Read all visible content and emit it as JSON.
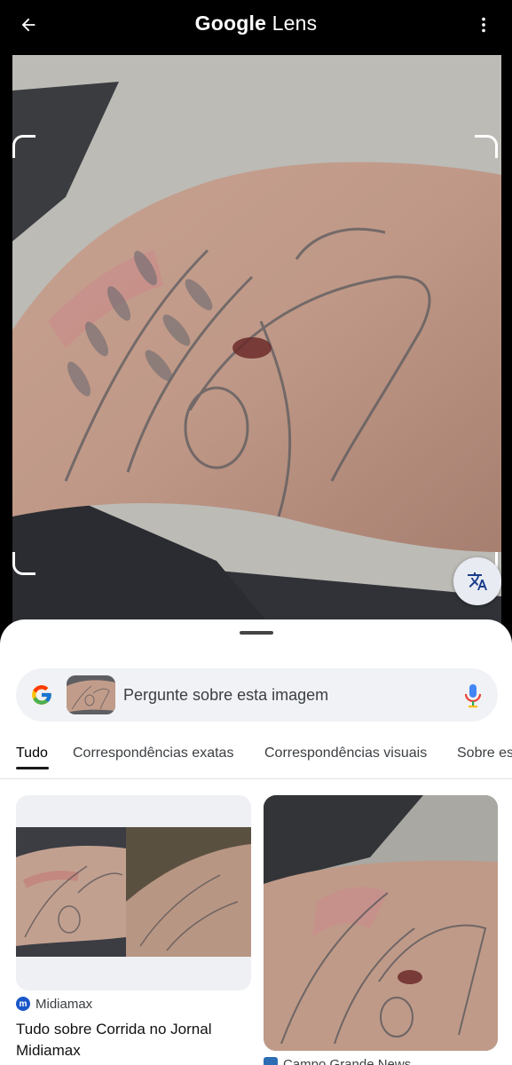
{
  "app": {
    "title_brand": "Google",
    "title_product": "Lens"
  },
  "icons": {
    "back": "arrow-left-icon",
    "more": "more-vert-icon",
    "translate": "translate-icon",
    "google": "google-g-icon",
    "mic": "mic-icon"
  },
  "search": {
    "placeholder": "Pergunte sobre esta imagem"
  },
  "tabs": [
    {
      "label": "Tudo",
      "active": true
    },
    {
      "label": "Correspondências exatas",
      "active": false
    },
    {
      "label": "Correspondências visuais",
      "active": false
    },
    {
      "label": "Sobre es",
      "active": false
    }
  ],
  "results": [
    {
      "source": "Midiamax",
      "title": "Tudo sobre Corrida no Jornal Midiamax"
    },
    {
      "source": "Campo Grande News",
      "title": ""
    }
  ],
  "colors": {
    "accent": "#1a73e8",
    "sheet_bg": "#ffffff",
    "search_bg": "#f0f2f5"
  }
}
